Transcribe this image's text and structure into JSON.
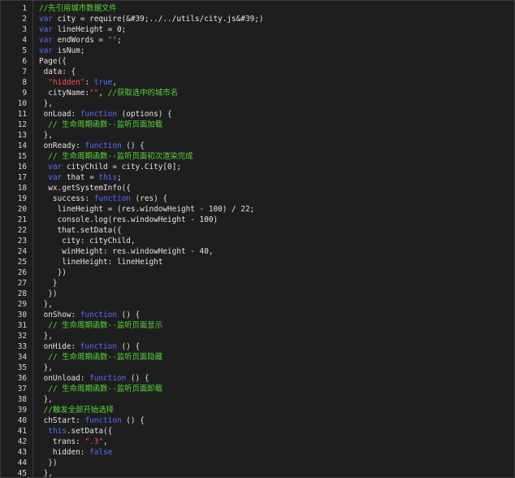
{
  "colors": {
    "background": "#1e1e1e",
    "plain": "#e4e4e4",
    "comment": "#57d83a",
    "keyword": "#5a6cff",
    "string": "#ff4c4c",
    "line_number": "#d8d8d8"
  },
  "lines": [
    {
      "n": "1",
      "tokens": [
        {
          "t": "//先引用城市数据文件",
          "c": "com"
        }
      ]
    },
    {
      "n": "2",
      "tokens": [
        {
          "t": "var",
          "c": "kw"
        },
        {
          "t": " city = require(&#39;../../utils/city.js&#39;)",
          "c": "plain"
        }
      ]
    },
    {
      "n": "3",
      "tokens": [
        {
          "t": "var",
          "c": "kw"
        },
        {
          "t": " lineHeight = 0;",
          "c": "plain"
        }
      ]
    },
    {
      "n": "4",
      "tokens": [
        {
          "t": "var",
          "c": "kw"
        },
        {
          "t": " endWords = ",
          "c": "plain"
        },
        {
          "t": "\"\"",
          "c": "str"
        },
        {
          "t": ";",
          "c": "plain"
        }
      ]
    },
    {
      "n": "5",
      "tokens": [
        {
          "t": "var",
          "c": "kw"
        },
        {
          "t": " isNum;",
          "c": "plain"
        }
      ]
    },
    {
      "n": "6",
      "tokens": [
        {
          "t": "Page({",
          "c": "plain"
        }
      ]
    },
    {
      "n": "7",
      "tokens": [
        {
          "t": " data: {",
          "c": "plain"
        }
      ]
    },
    {
      "n": "8",
      "tokens": [
        {
          "t": "  ",
          "c": "plain"
        },
        {
          "t": "\"hidden\"",
          "c": "str"
        },
        {
          "t": ": ",
          "c": "plain"
        },
        {
          "t": "true",
          "c": "bool"
        },
        {
          "t": ",",
          "c": "plain"
        }
      ]
    },
    {
      "n": "9",
      "tokens": [
        {
          "t": "  cityName:",
          "c": "plain"
        },
        {
          "t": "\"\"",
          "c": "str"
        },
        {
          "t": ", ",
          "c": "plain"
        },
        {
          "t": "//获取选中的城市名",
          "c": "com"
        }
      ]
    },
    {
      "n": "10",
      "tokens": [
        {
          "t": " },",
          "c": "plain"
        }
      ]
    },
    {
      "n": "11",
      "tokens": [
        {
          "t": " onLoad: ",
          "c": "plain"
        },
        {
          "t": "function",
          "c": "kw"
        },
        {
          "t": " (options) {",
          "c": "plain"
        }
      ]
    },
    {
      "n": "12",
      "tokens": [
        {
          "t": "  ",
          "c": "plain"
        },
        {
          "t": "// 生命周期函数--监听页面加载",
          "c": "com"
        }
      ]
    },
    {
      "n": "13",
      "tokens": [
        {
          "t": " },",
          "c": "plain"
        }
      ]
    },
    {
      "n": "14",
      "tokens": [
        {
          "t": " onReady: ",
          "c": "plain"
        },
        {
          "t": "function",
          "c": "kw"
        },
        {
          "t": " () {",
          "c": "plain"
        }
      ]
    },
    {
      "n": "15",
      "tokens": [
        {
          "t": "  ",
          "c": "plain"
        },
        {
          "t": "// 生命周期函数--监听页面初次渲染完成",
          "c": "com"
        }
      ]
    },
    {
      "n": "16",
      "tokens": [
        {
          "t": "  ",
          "c": "plain"
        },
        {
          "t": "var",
          "c": "kw"
        },
        {
          "t": " cityChild = city.City[0];",
          "c": "plain"
        }
      ]
    },
    {
      "n": "17",
      "tokens": [
        {
          "t": "  ",
          "c": "plain"
        },
        {
          "t": "var",
          "c": "kw"
        },
        {
          "t": " that = ",
          "c": "plain"
        },
        {
          "t": "this",
          "c": "kw"
        },
        {
          "t": ";",
          "c": "plain"
        }
      ]
    },
    {
      "n": "18",
      "tokens": [
        {
          "t": "  wx.getSystemInfo({",
          "c": "plain"
        }
      ]
    },
    {
      "n": "19",
      "tokens": [
        {
          "t": "   success: ",
          "c": "plain"
        },
        {
          "t": "function",
          "c": "kw"
        },
        {
          "t": " (res) {",
          "c": "plain"
        }
      ]
    },
    {
      "n": "20",
      "tokens": [
        {
          "t": "    lineHeight = (res.windowHeight - 100) / 22;",
          "c": "plain"
        }
      ]
    },
    {
      "n": "21",
      "tokens": [
        {
          "t": "    console.log(res.windowHeight - 100)",
          "c": "plain"
        }
      ]
    },
    {
      "n": "22",
      "tokens": [
        {
          "t": "    that.setData({",
          "c": "plain"
        }
      ]
    },
    {
      "n": "23",
      "tokens": [
        {
          "t": "     city: cityChild,",
          "c": "plain"
        }
      ]
    },
    {
      "n": "24",
      "tokens": [
        {
          "t": "     winHeight: res.windowHeight - 40,",
          "c": "plain"
        }
      ]
    },
    {
      "n": "25",
      "tokens": [
        {
          "t": "     lineHeight: lineHeight",
          "c": "plain"
        }
      ]
    },
    {
      "n": "26",
      "tokens": [
        {
          "t": "    })",
          "c": "plain"
        }
      ]
    },
    {
      "n": "27",
      "tokens": [
        {
          "t": "   }",
          "c": "plain"
        }
      ]
    },
    {
      "n": "28",
      "tokens": [
        {
          "t": "  })",
          "c": "plain"
        }
      ]
    },
    {
      "n": "29",
      "tokens": [
        {
          "t": " },",
          "c": "plain"
        }
      ]
    },
    {
      "n": "30",
      "tokens": [
        {
          "t": " onShow: ",
          "c": "plain"
        },
        {
          "t": "function",
          "c": "kw"
        },
        {
          "t": " () {",
          "c": "plain"
        }
      ]
    },
    {
      "n": "31",
      "tokens": [
        {
          "t": "  ",
          "c": "plain"
        },
        {
          "t": "// 生命周期函数--监听页面显示",
          "c": "com"
        }
      ]
    },
    {
      "n": "32",
      "tokens": [
        {
          "t": " },",
          "c": "plain"
        }
      ]
    },
    {
      "n": "33",
      "tokens": [
        {
          "t": " onHide: ",
          "c": "plain"
        },
        {
          "t": "function",
          "c": "kw"
        },
        {
          "t": " () {",
          "c": "plain"
        }
      ]
    },
    {
      "n": "34",
      "tokens": [
        {
          "t": "  ",
          "c": "plain"
        },
        {
          "t": "// 生命周期函数--监听页面隐藏",
          "c": "com"
        }
      ]
    },
    {
      "n": "35",
      "tokens": [
        {
          "t": " },",
          "c": "plain"
        }
      ]
    },
    {
      "n": "36",
      "tokens": [
        {
          "t": " onUnload: ",
          "c": "plain"
        },
        {
          "t": "function",
          "c": "kw"
        },
        {
          "t": " () {",
          "c": "plain"
        }
      ]
    },
    {
      "n": "37",
      "tokens": [
        {
          "t": "  ",
          "c": "plain"
        },
        {
          "t": "// 生命周期函数--监听页面卸载",
          "c": "com"
        }
      ]
    },
    {
      "n": "38",
      "tokens": [
        {
          "t": " },",
          "c": "plain"
        }
      ]
    },
    {
      "n": "39",
      "tokens": [
        {
          "t": " ",
          "c": "plain"
        },
        {
          "t": "//触发全部开始选择",
          "c": "com"
        }
      ]
    },
    {
      "n": "40",
      "tokens": [
        {
          "t": " chStart: ",
          "c": "plain"
        },
        {
          "t": "function",
          "c": "kw"
        },
        {
          "t": " () {",
          "c": "plain"
        }
      ]
    },
    {
      "n": "41",
      "tokens": [
        {
          "t": "  ",
          "c": "plain"
        },
        {
          "t": "this",
          "c": "kw"
        },
        {
          "t": ".setData({",
          "c": "plain"
        }
      ]
    },
    {
      "n": "42",
      "tokens": [
        {
          "t": "   trans: ",
          "c": "plain"
        },
        {
          "t": "\".3\"",
          "c": "str"
        },
        {
          "t": ",",
          "c": "plain"
        }
      ]
    },
    {
      "n": "43",
      "tokens": [
        {
          "t": "   hidden: ",
          "c": "plain"
        },
        {
          "t": "false",
          "c": "bool"
        }
      ]
    },
    {
      "n": "44",
      "tokens": [
        {
          "t": "  })",
          "c": "plain"
        }
      ]
    },
    {
      "n": "45",
      "tokens": [
        {
          "t": " },",
          "c": "plain"
        }
      ]
    }
  ]
}
